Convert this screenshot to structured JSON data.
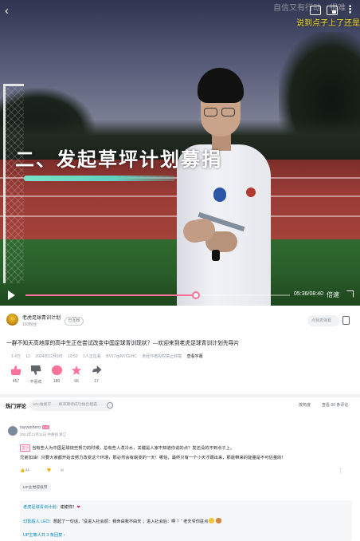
{
  "player": {
    "danmaku_faded": "自信又有行动",
    "danmaku_faded_2": "很难",
    "danmaku_live": "说到点子上了还是要扫",
    "overlay_title": "二、发起草坪计划募捐",
    "time": "05:36/08:40",
    "speed_label": "倍速",
    "progress": 0.645
  },
  "uploader": {
    "name": "老虎足球青训计划",
    "fans": "150粉丝",
    "follow_label": "已互粉",
    "danmaku_placeholder": "点我发弹幕"
  },
  "video": {
    "title": "一群不知天高地厚的高中生正在尝试改变中国足球青训现状？---欢迎来到老虎足球青训计划先导片",
    "views": "1.4万",
    "danmaku_count": "12",
    "date": "2024年12月9日",
    "time": "19:52",
    "watching": "1人正在看",
    "bvid": "BV17xpNYCEHC",
    "warning": "未经作者授权禁止转载",
    "subtitle_label": "查看字幕"
  },
  "actions": [
    {
      "name": "like",
      "count": "457"
    },
    {
      "name": "dislike",
      "count": "不喜欢"
    },
    {
      "name": "coin",
      "count": "180"
    },
    {
      "name": "favorite",
      "count": "66"
    },
    {
      "name": "share",
      "count": "17"
    }
  ],
  "comments": {
    "tab_label": "热门评论",
    "input_placeholder": "who谁播求……概率期待成功抛出相遇……",
    "sort_label": "按热度",
    "count_label": "查看 60 条评论",
    "first": {
      "user": "rayvanhero",
      "level": "LV6",
      "time": "2024年12月11日 中重视 浙江",
      "tag": "置顶",
      "line1": "当有些人为中国足球烧些努力的时候，总有些人泼冷水，关键是人家不知道你说的点？发还没的不到点子上。",
      "line2": "兄弟加油！只要大家都开始去努力改变这个环境，那必然会有蜕变的一天！哪怕，最终只有一个小天才踢出来，那能带来的能量是不可估量的！",
      "likes": "44",
      "up_liked": "UP主觉得很赞"
    },
    "replies": [
      {
        "who": "老虎足球青训计划",
        "text": "：谢谢你！"
      },
      {
        "who": "幻影超人 LEO",
        "text": "：想起了一句话，“没进入社会前：我命由我不由天 ；进入社会后：啊 ！” 老天爷你驻点"
      }
    ],
    "more_replies": "UP主等人共 3 条回复 ›"
  }
}
